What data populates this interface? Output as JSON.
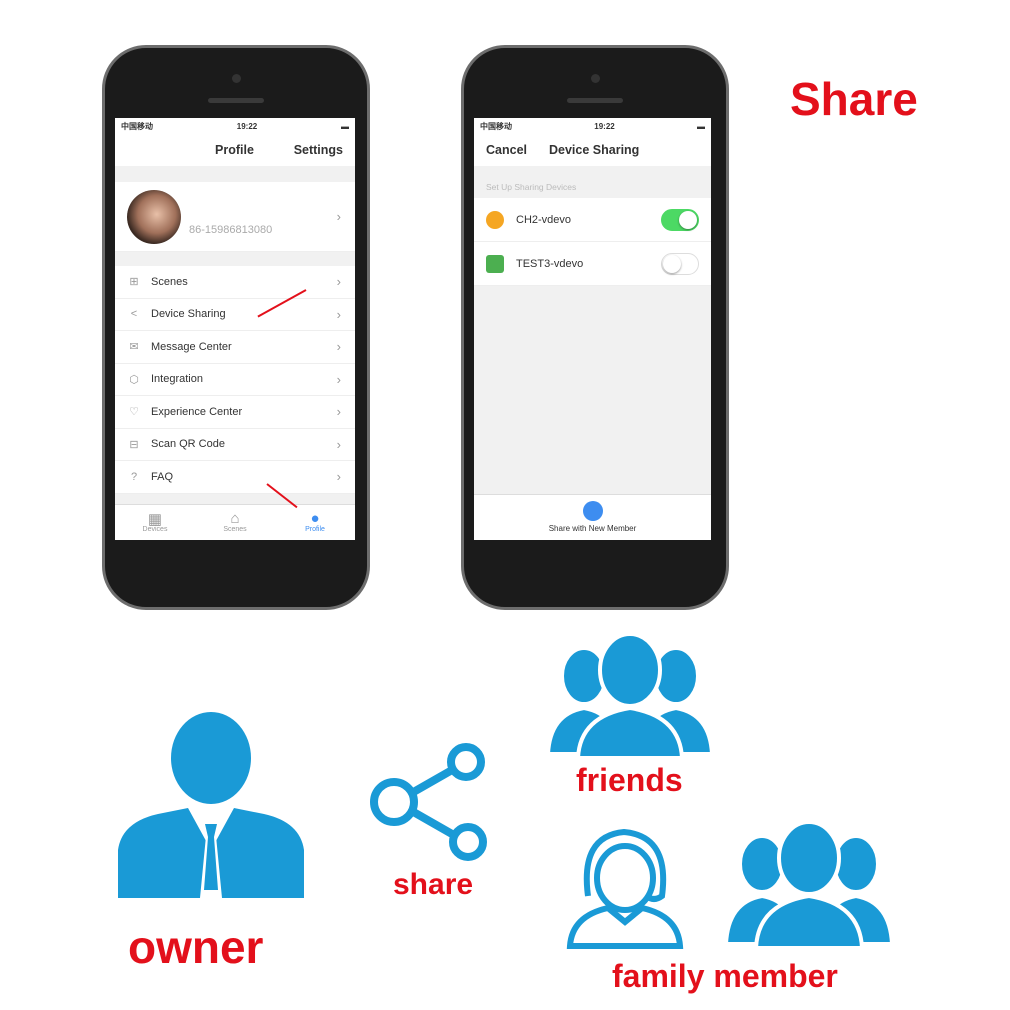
{
  "title": "Share",
  "phone1": {
    "status": {
      "carrier": "中国移动",
      "time": "19:22"
    },
    "nav": {
      "title": "Profile",
      "right": "Settings"
    },
    "profile": {
      "phone": "86-15986813080"
    },
    "menu": [
      {
        "label": "Scenes",
        "icon": "scenes-icon",
        "glyph": "⊞"
      },
      {
        "label": "Device Sharing",
        "icon": "share-icon",
        "glyph": "<"
      },
      {
        "label": "Message Center",
        "icon": "mail-icon",
        "glyph": "✉"
      },
      {
        "label": "Integration",
        "icon": "cube-icon",
        "glyph": "⬡"
      },
      {
        "label": "Experience Center",
        "icon": "heart-icon",
        "glyph": "♡"
      },
      {
        "label": "Scan QR Code",
        "icon": "scan-icon",
        "glyph": "⊟"
      },
      {
        "label": "FAQ",
        "icon": "help-icon",
        "glyph": "?"
      }
    ],
    "tabs": [
      {
        "label": "Devices",
        "glyph": "▦",
        "active": false
      },
      {
        "label": "Scenes",
        "glyph": "⌂",
        "active": false
      },
      {
        "label": "Profile",
        "glyph": "●",
        "active": true
      }
    ]
  },
  "phone2": {
    "status": {
      "carrier": "中国移动",
      "time": "19:22"
    },
    "nav": {
      "left": "Cancel",
      "title": "Device Sharing"
    },
    "section": "Set Up Sharing Devices",
    "devices": [
      {
        "name": "CH2-vdevo",
        "color": "#f5a623",
        "on": true
      },
      {
        "name": "TEST3-vdevo",
        "color": "#4caf50",
        "on": false
      }
    ],
    "footer": "Share with New Member"
  },
  "labels": {
    "owner": "owner",
    "share": "share",
    "friends": "friends",
    "family": "family member"
  },
  "colors": {
    "accent_red": "#e3101b",
    "icon_blue": "#1a9ad6",
    "toggle_on": "#4cd964"
  }
}
